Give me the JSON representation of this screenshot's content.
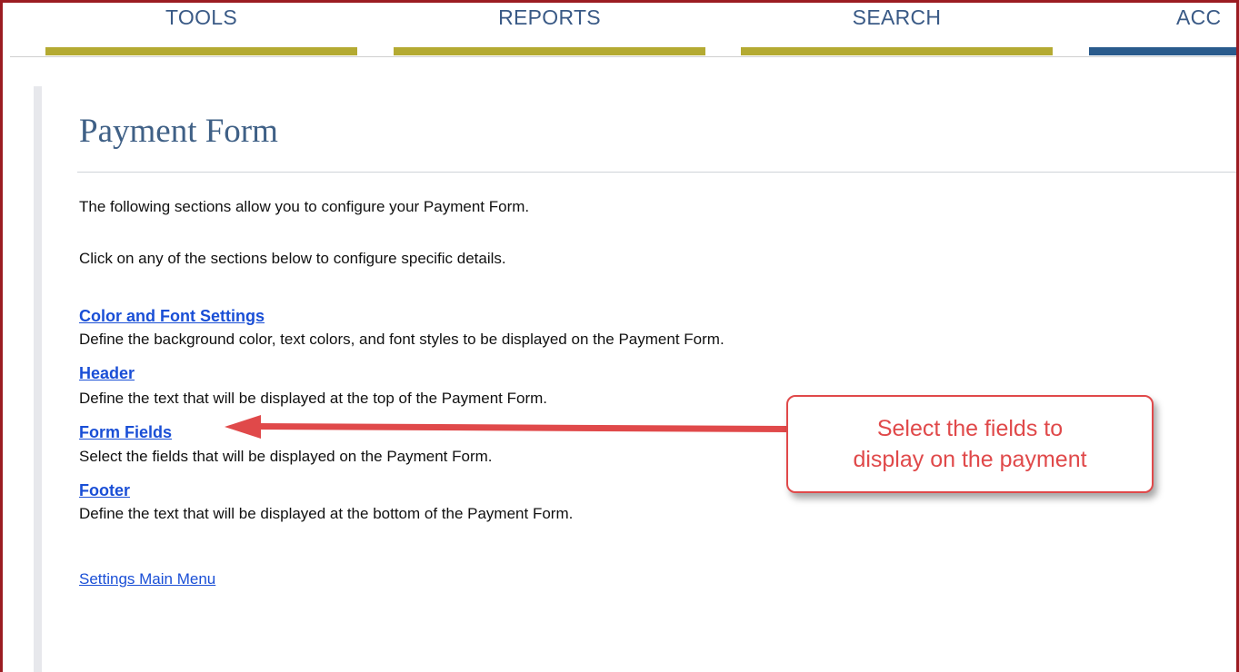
{
  "nav": {
    "tabs": [
      {
        "label": "TOOLS",
        "bar_color": "#b4aa32"
      },
      {
        "label": "REPORTS",
        "bar_color": "#b4aa32"
      },
      {
        "label": "SEARCH",
        "bar_color": "#b4aa32"
      },
      {
        "label": "ACC",
        "bar_color": "#2a5b8c"
      }
    ]
  },
  "page": {
    "title": "Payment Form",
    "intro": "The following sections allow you to configure your Payment Form.",
    "instruction": "Click on any of the sections below to configure specific details."
  },
  "sections": [
    {
      "link": "Color and Font Settings",
      "description": "Define the background color, text colors, and font styles to be displayed on the Payment Form."
    },
    {
      "link": "Header",
      "description": "Define the text that will be displayed at the top of the Payment Form."
    },
    {
      "link": "Form Fields",
      "description": "Select the fields that will be displayed on the Payment Form."
    },
    {
      "link": "Footer",
      "description": "Define the text that will be displayed at the bottom of the Payment Form."
    }
  ],
  "main_menu_link": "Settings Main Menu",
  "callout": {
    "line1": "Select the fields to",
    "line2": "display on the payment",
    "color": "#e0494a"
  },
  "colors": {
    "frame_border": "#9b1c22",
    "title": "#3f6086",
    "link": "#1a4fd6",
    "tab_text": "#3a5a86"
  }
}
